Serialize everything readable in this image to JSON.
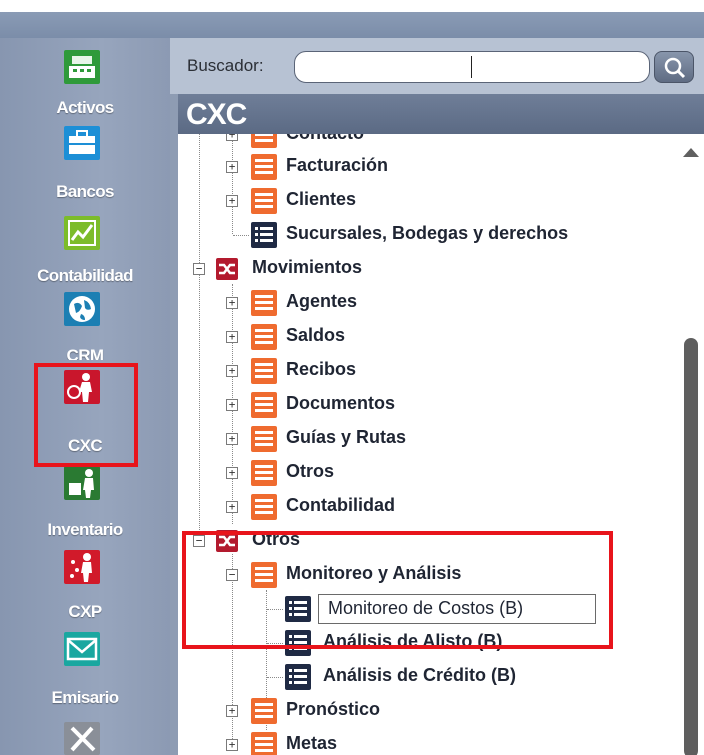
{
  "search": {
    "label": "Buscador:",
    "value": ""
  },
  "header": {
    "title": "CXC"
  },
  "sidebar": {
    "items": [
      {
        "label": "Activos",
        "icon": "cash-register-icon"
      },
      {
        "label": "Bancos",
        "icon": "briefcase-icon"
      },
      {
        "label": "Contabilidad",
        "icon": "chart-icon"
      },
      {
        "label": "CRM",
        "icon": "globe-icon"
      },
      {
        "label": "CXC",
        "icon": "cxc-person-icon"
      },
      {
        "label": "Inventario",
        "icon": "inventory-person-icon"
      },
      {
        "label": "CXP",
        "icon": "cxp-person-icon"
      },
      {
        "label": "Emisario",
        "icon": "envelope-icon"
      },
      {
        "label": "",
        "icon": "tools-icon"
      }
    ]
  },
  "tree": {
    "contacto": "Contacto",
    "facturacion": "Facturación",
    "clientes": "Clientes",
    "sucursales": "Sucursales, Bodegas y derechos",
    "movimientos": "Movimientos",
    "agentes": "Agentes",
    "saldos": "Saldos",
    "recibos": "Recibos",
    "documentos": "Documentos",
    "guias": "Guías y Rutas",
    "otros_sub": "Otros",
    "contabilidad": "Contabilidad",
    "otros": "Otros",
    "monitoreo": "Monitoreo y Análisis",
    "monitoreo_costos": "Monitoreo de Costos (B)",
    "analisis_alisto": "Análisis de Alisto (B)",
    "analisis_credito": "Análisis de Crédito (B)",
    "pronostico": "Pronóstico",
    "metas": "Metas"
  },
  "colors": {
    "highlight": "#e8141b",
    "list_icon": "#ef6b2f",
    "dark_icon": "#1f2a44",
    "group_icon": "#b31a2e"
  }
}
